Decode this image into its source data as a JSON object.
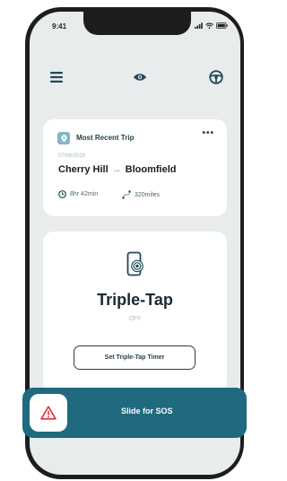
{
  "status_bar": {
    "time": "9:41"
  },
  "header": {
    "icons": [
      "menu-icon",
      "eye-icon",
      "steering-wheel-icon"
    ]
  },
  "recent_trip": {
    "title": "Most Recent Trip",
    "more": "•••",
    "date": "07/06/2020",
    "origin": "Cherry Hill",
    "arrow": "→",
    "destination": "Bloomfield",
    "duration": "8hr 42min",
    "distance": "320miles"
  },
  "triple_tap": {
    "title": "Triple-Tap",
    "status": "OFF",
    "button_label": "Set Triple-Tap Timer"
  },
  "sos": {
    "label": "Slide for SOS"
  },
  "colors": {
    "accent": "#1f6a7f",
    "dark": "#26414d",
    "warning": "#e0303a"
  }
}
